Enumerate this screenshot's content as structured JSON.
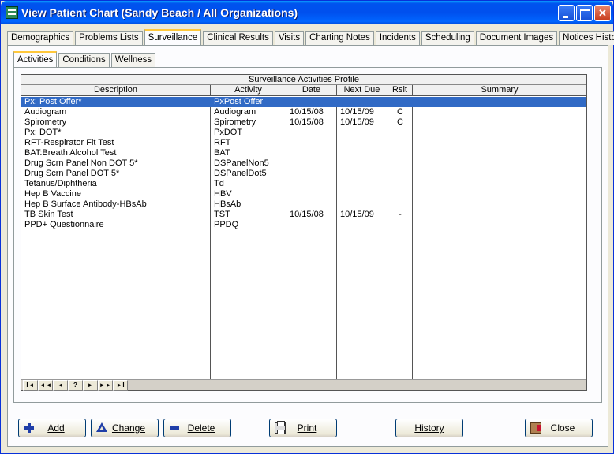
{
  "window": {
    "title": "View Patient Chart (Sandy Beach / All Organizations)"
  },
  "main_tabs": [
    {
      "label": "Demographics",
      "active": false
    },
    {
      "label": "Problems Lists",
      "active": false
    },
    {
      "label": "Surveillance",
      "active": true
    },
    {
      "label": "Clinical Results",
      "active": false
    },
    {
      "label": "Visits",
      "active": false
    },
    {
      "label": "Charting Notes",
      "active": false
    },
    {
      "label": "Incidents",
      "active": false
    },
    {
      "label": "Scheduling",
      "active": false
    },
    {
      "label": "Document Images",
      "active": false
    },
    {
      "label": "Notices History",
      "active": false
    }
  ],
  "sub_tabs": [
    {
      "label": "Activities",
      "active": true
    },
    {
      "label": "Conditions",
      "active": false
    },
    {
      "label": "Wellness",
      "active": false
    }
  ],
  "grid": {
    "title": "Surveillance Activities Profile",
    "columns": [
      "Description",
      "Activity",
      "Date",
      "Next Due",
      "Rslt",
      "Summary"
    ],
    "rows": [
      {
        "description": "Px: Post Offer*",
        "activity": "PxPost Offer",
        "date": "",
        "next_due": "",
        "rslt": "",
        "summary": "",
        "selected": true
      },
      {
        "description": "Audiogram",
        "activity": "Audiogram",
        "date": "10/15/08",
        "next_due": "10/15/09",
        "rslt": "C",
        "summary": "",
        "selected": false
      },
      {
        "description": "Spirometry",
        "activity": "Spirometry",
        "date": "10/15/08",
        "next_due": "10/15/09",
        "rslt": "C",
        "summary": "",
        "selected": false
      },
      {
        "description": "Px: DOT*",
        "activity": "PxDOT",
        "date": "",
        "next_due": "",
        "rslt": "",
        "summary": "",
        "selected": false
      },
      {
        "description": "RFT-Respirator Fit Test",
        "activity": "RFT",
        "date": "",
        "next_due": "",
        "rslt": "",
        "summary": "",
        "selected": false
      },
      {
        "description": "BAT:Breath Alcohol Test",
        "activity": "BAT",
        "date": "",
        "next_due": "",
        "rslt": "",
        "summary": "",
        "selected": false
      },
      {
        "description": "Drug Scrn Panel Non DOT 5*",
        "activity": "DSPanelNon5",
        "date": "",
        "next_due": "",
        "rslt": "",
        "summary": "",
        "selected": false
      },
      {
        "description": "Drug Scrn Panel DOT 5*",
        "activity": "DSPanelDot5",
        "date": "",
        "next_due": "",
        "rslt": "",
        "summary": "",
        "selected": false
      },
      {
        "description": "Tetanus/Diphtheria",
        "activity": "Td",
        "date": "",
        "next_due": "",
        "rslt": "",
        "summary": "",
        "selected": false
      },
      {
        "description": "Hep B Vaccine",
        "activity": "HBV",
        "date": "",
        "next_due": "",
        "rslt": "",
        "summary": "",
        "selected": false
      },
      {
        "description": "Hep B Surface Antibody-HBsAb",
        "activity": "HBsAb",
        "date": "",
        "next_due": "",
        "rslt": "",
        "summary": "",
        "selected": false
      },
      {
        "description": "TB Skin Test",
        "activity": "TST",
        "date": "10/15/08",
        "next_due": "10/15/09",
        "rslt": "-",
        "summary": "",
        "selected": false
      },
      {
        "description": "PPD+ Questionnaire",
        "activity": "PPDQ",
        "date": "",
        "next_due": "",
        "rslt": "",
        "summary": "",
        "selected": false
      }
    ]
  },
  "navigator": [
    "I◄",
    "◄◄",
    "◄",
    "?",
    "►",
    "►►",
    "►I"
  ],
  "buttons": {
    "add": "Add",
    "change": "Change",
    "delete": "Delete",
    "print": "Print",
    "history": "History",
    "close": "Close"
  },
  "icons": {
    "add": "plus-icon",
    "change": "triangle-icon",
    "delete": "minus-icon",
    "print": "printer-icon",
    "close": "door-exit-icon"
  },
  "colors": {
    "titlebar": "#0053ee",
    "selection": "#316ac5",
    "tab_highlight": "#ffc83c",
    "button_icon": "#1f3ea8"
  }
}
